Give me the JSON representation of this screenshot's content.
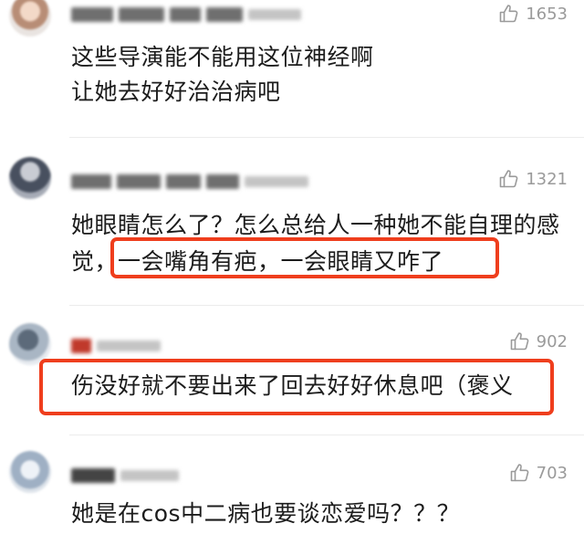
{
  "comments": [
    {
      "likes": "1653",
      "lines": [
        "这些导演能不能用这位神经啊",
        "让她去好好治治病吧"
      ]
    },
    {
      "likes": "1321",
      "lines": [
        "她眼睛怎么了？怎么总给人一种她不能自理的感",
        "觉，一会嘴角有疤，一会眼睛又咋了"
      ]
    },
    {
      "likes": "902",
      "lines": [
        "伤没好就不要出来了回去好好休息吧（褒义"
      ]
    },
    {
      "likes": "703",
      "lines": [
        "她是在cos中二病也要谈恋爱吗？？？"
      ]
    }
  ],
  "icons": {
    "like": "thumbs-up-icon"
  },
  "colors": {
    "highlight": "#ef3e1d",
    "text": "#1c1c1c",
    "meta": "#9a9a9a"
  }
}
